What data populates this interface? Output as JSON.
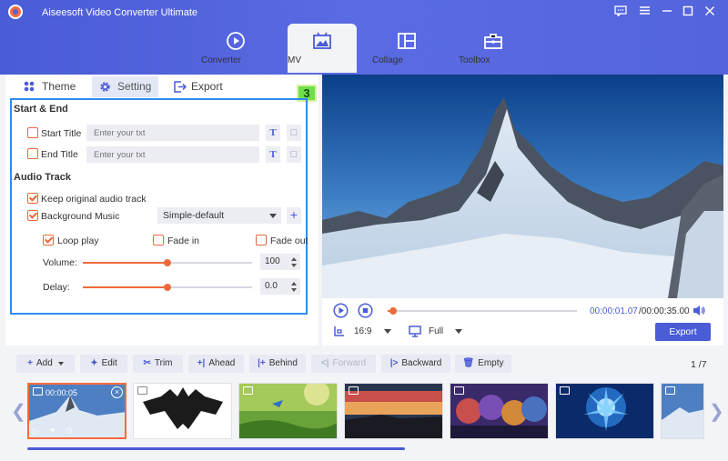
{
  "app": {
    "title": "Aiseesoft Video Converter Ultimate"
  },
  "nav": [
    {
      "label": "Converter",
      "icon": "converter-icon"
    },
    {
      "label": "MV",
      "icon": "mv-icon"
    },
    {
      "label": "Collage",
      "icon": "collage-icon"
    },
    {
      "label": "Toolbox",
      "icon": "toolbox-icon"
    }
  ],
  "subtabs": {
    "theme": "Theme",
    "setting": "Setting",
    "export": "Export"
  },
  "badge": "3",
  "start_end": {
    "title": "Start & End",
    "start_title_label": "Start Title",
    "start_title_placeholder": "Enter your txt",
    "end_title_label": "End Title",
    "end_title_placeholder": "Enter your txt"
  },
  "audio": {
    "title": "Audio Track",
    "keep_original_label": "Keep original audio track",
    "keep_original_checked": true,
    "bg_music_label": "Background Music",
    "bg_music_checked": true,
    "bg_music_value": "Simple-default",
    "loop_label": "Loop play",
    "loop_checked": true,
    "fade_in_label": "Fade in",
    "fade_in_checked": false,
    "fade_out_label": "Fade out",
    "fade_out_checked": false,
    "volume_label": "Volume:",
    "volume_value": "100",
    "volume_level": 0.5,
    "delay_label": "Delay:",
    "delay_value": "0.0",
    "delay_level": 0.5
  },
  "player": {
    "time_current": "00:00:01.07",
    "time_total": "/00:00:35.00",
    "aspect": "16:9",
    "view": "Full",
    "export_label": "Export",
    "progress": 0.03
  },
  "toolbar": {
    "add": "Add",
    "edit": "Edit",
    "trim": "Trim",
    "ahead": "Ahead",
    "behind": "Behind",
    "forward": "Forward",
    "backward": "Backward",
    "empty": "Empty",
    "page_current": "1",
    "page_total": "7"
  },
  "filmstrip": {
    "first_duration": "00:00:05"
  },
  "colors": {
    "accent": "#4a5cd6",
    "orange": "#ee6b3b",
    "highlight_box": "#2d8cf0",
    "badge": "#6fe04a"
  }
}
